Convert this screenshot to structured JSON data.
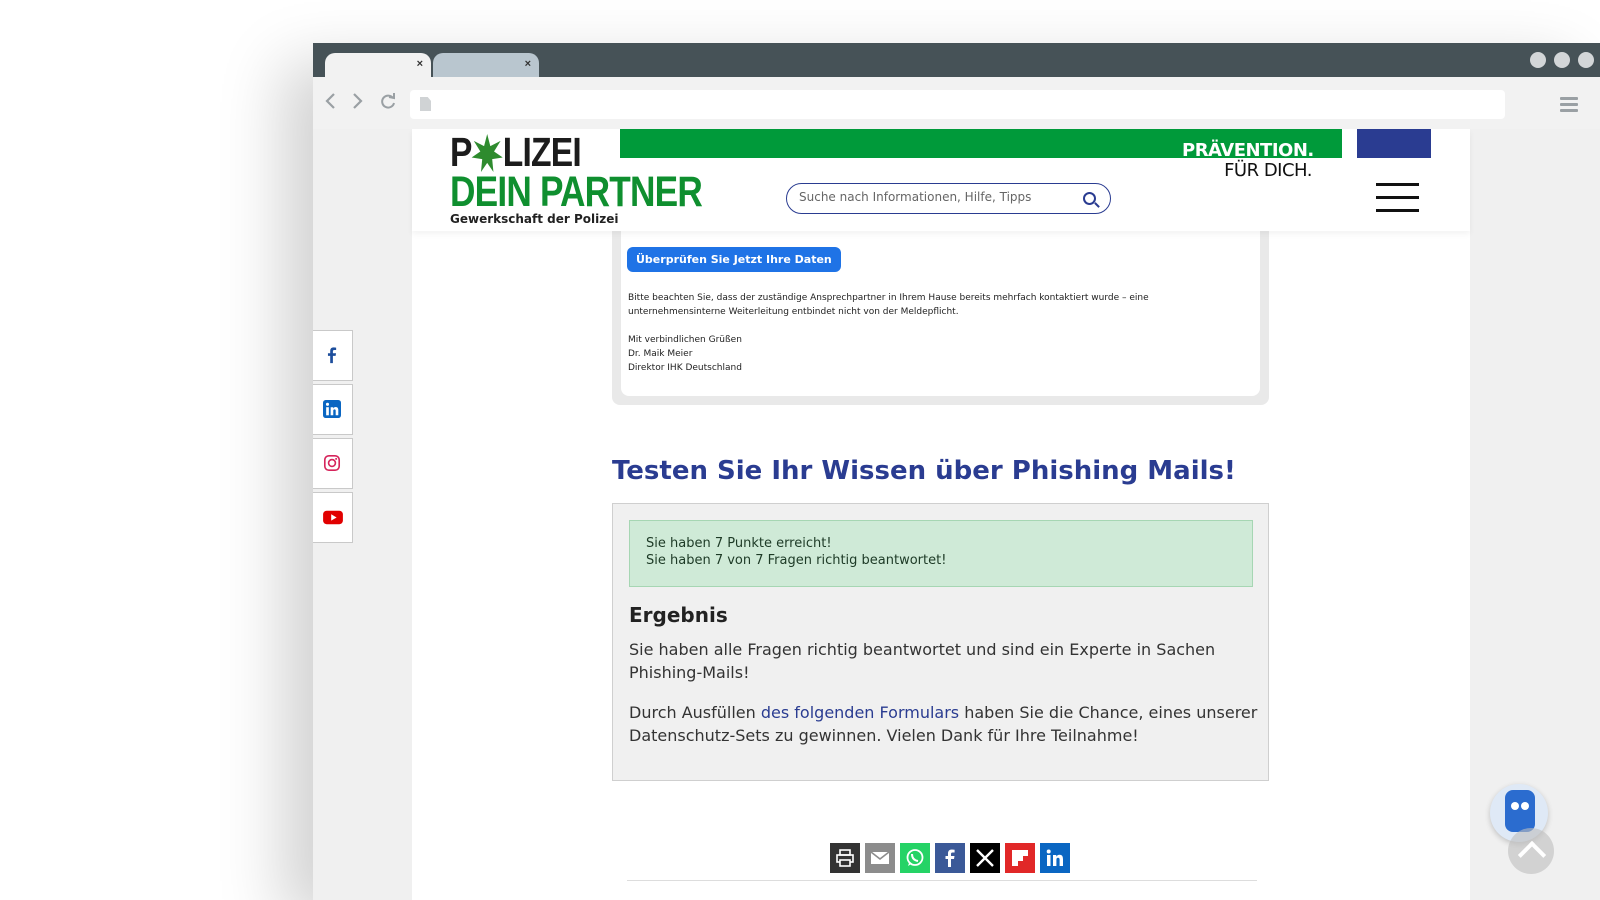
{
  "browser": {
    "tabs": [
      {
        "close": "×"
      },
      {
        "close": "×"
      }
    ]
  },
  "header": {
    "logo": {
      "line1_a": "P",
      "line1_b": "LIZEI",
      "line2": "DEIN PARTNER",
      "line3": "Gewerkschaft der Polizei"
    },
    "slogan": {
      "line1": "PRÄVENTION.",
      "line2": "FÜR DICH."
    },
    "search": {
      "placeholder": "Suche nach Informationen, Hilfe, Tipps"
    },
    "colors": {
      "green": "#009a3a",
      "blue": "#2a3c91"
    }
  },
  "social": [
    "facebook-icon",
    "linkedin-icon",
    "instagram-icon",
    "youtube-icon"
  ],
  "mail": {
    "button": "Überprüfen Sie Jetzt Ihre Daten",
    "notice_line1": "Bitte beachten Sie, dass der zuständige Ansprechpartner in Ihrem Hause bereits mehrfach kontaktiert wurde – eine",
    "notice_line2": "unternehmensinterne Weiterleitung entbindet nicht von der Meldepflicht.",
    "closing": "Mit verbindlichen Grüßen",
    "name": "Dr. Maik Meier",
    "role": "Direktor IHK Deutschland"
  },
  "quiz": {
    "title": "Testen Sie Ihr Wissen über Phishing Mails!",
    "score_line1": "Sie haben 7 Punkte erreicht!",
    "score_line2": "Sie haben 7 von 7 Fragen richtig beantwortet!",
    "result_heading": "Ergebnis",
    "result_text": "Sie haben alle Fragen richtig beantwortet und sind ein Experte in Sachen Phishing-Mails!",
    "form_prefix": "Durch Ausfüllen ",
    "form_link": "des folgenden Formulars",
    "form_suffix": " haben Sie die Chance, eines unserer Datenschutz-Sets zu gewinnen. Vielen Dank für Ihre Teilnahme!"
  },
  "share": [
    {
      "icon": "print-icon",
      "color": "#333333"
    },
    {
      "icon": "email-icon",
      "color": "#8c8c8c"
    },
    {
      "icon": "whatsapp-icon",
      "color": "#25d366"
    },
    {
      "icon": "facebook-icon",
      "color": "#3b5998"
    },
    {
      "icon": "x-icon",
      "color": "#000000"
    },
    {
      "icon": "flipboard-icon",
      "color": "#e12828"
    },
    {
      "icon": "linkedin-icon",
      "color": "#0a66c2"
    }
  ]
}
